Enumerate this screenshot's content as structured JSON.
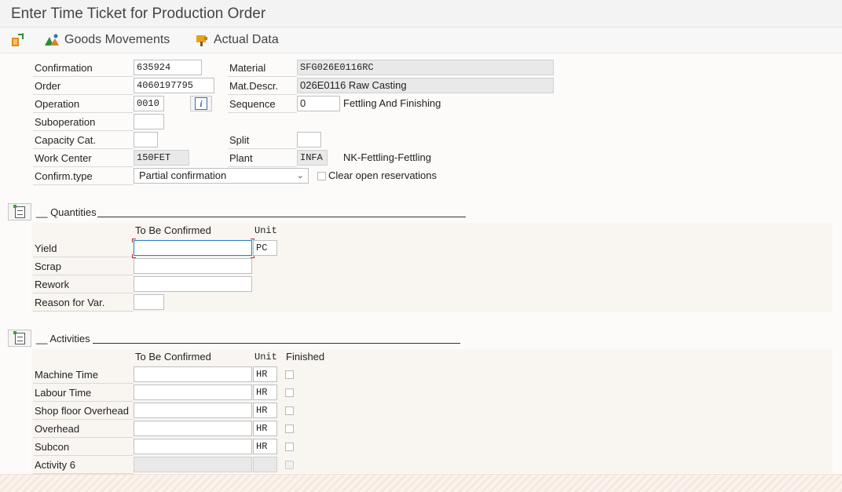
{
  "window": {
    "title": "Enter Time Ticket for Production Order"
  },
  "toolbar": {
    "goods_movements": "Goods Movements",
    "actual_data": "Actual Data"
  },
  "header": {
    "confirmation": {
      "label": "Confirmation",
      "value": "635924"
    },
    "order": {
      "label": "Order",
      "value": "4060197795"
    },
    "operation": {
      "label": "Operation",
      "value": "0010"
    },
    "suboperation": {
      "label": "Suboperation",
      "value": ""
    },
    "capacity_cat": {
      "label": "Capacity Cat.",
      "value": ""
    },
    "work_center": {
      "label": "Work Center",
      "value": "150FET"
    },
    "confirm_type": {
      "label": "Confirm.type",
      "value": "Partial confirmation"
    },
    "material": {
      "label": "Material",
      "value": "SFG026E0116RC"
    },
    "mat_descr": {
      "label": "Mat.Descr.",
      "value": "026E0116 Raw Casting"
    },
    "sequence": {
      "label": "Sequence",
      "value": "0",
      "text": "Fettling And Finishing"
    },
    "split": {
      "label": "Split",
      "value": ""
    },
    "plant": {
      "label": "Plant",
      "value": "INFA",
      "text": "NK-Fettling-Fettling"
    },
    "clear_reservations": {
      "label": "Clear open reservations",
      "checked": false
    }
  },
  "quantities": {
    "title": "__ Quantities",
    "col_to_be_confirmed": "To Be Confirmed",
    "col_unit": "Unit",
    "rows": [
      {
        "label": "Yield",
        "value": "",
        "unit": "PC"
      },
      {
        "label": "Scrap",
        "value": ""
      },
      {
        "label": "Rework",
        "value": ""
      },
      {
        "label": "Reason for Var.",
        "value": ""
      }
    ]
  },
  "activities": {
    "title": "__ Activities",
    "col_to_be_confirmed": "To Be Confirmed",
    "col_unit": "Unit",
    "col_finished": "Finished",
    "rows": [
      {
        "label": "Machine Time",
        "value": "",
        "unit": "HR",
        "finished": false
      },
      {
        "label": "Labour Time",
        "value": "",
        "unit": "HR",
        "finished": false
      },
      {
        "label": "Shop floor Overhead",
        "value": "",
        "unit": "HR",
        "finished": false
      },
      {
        "label": "Overhead",
        "value": "",
        "unit": "HR",
        "finished": false
      },
      {
        "label": "Subcon",
        "value": "",
        "unit": "HR",
        "finished": false
      },
      {
        "label": "Activity 6",
        "value": "",
        "unit": "",
        "finished": false
      }
    ]
  },
  "colors": {
    "accent": "#2f7fc8",
    "required_marker": "#c0282d",
    "readonly_bg": "#e9e9e9"
  }
}
